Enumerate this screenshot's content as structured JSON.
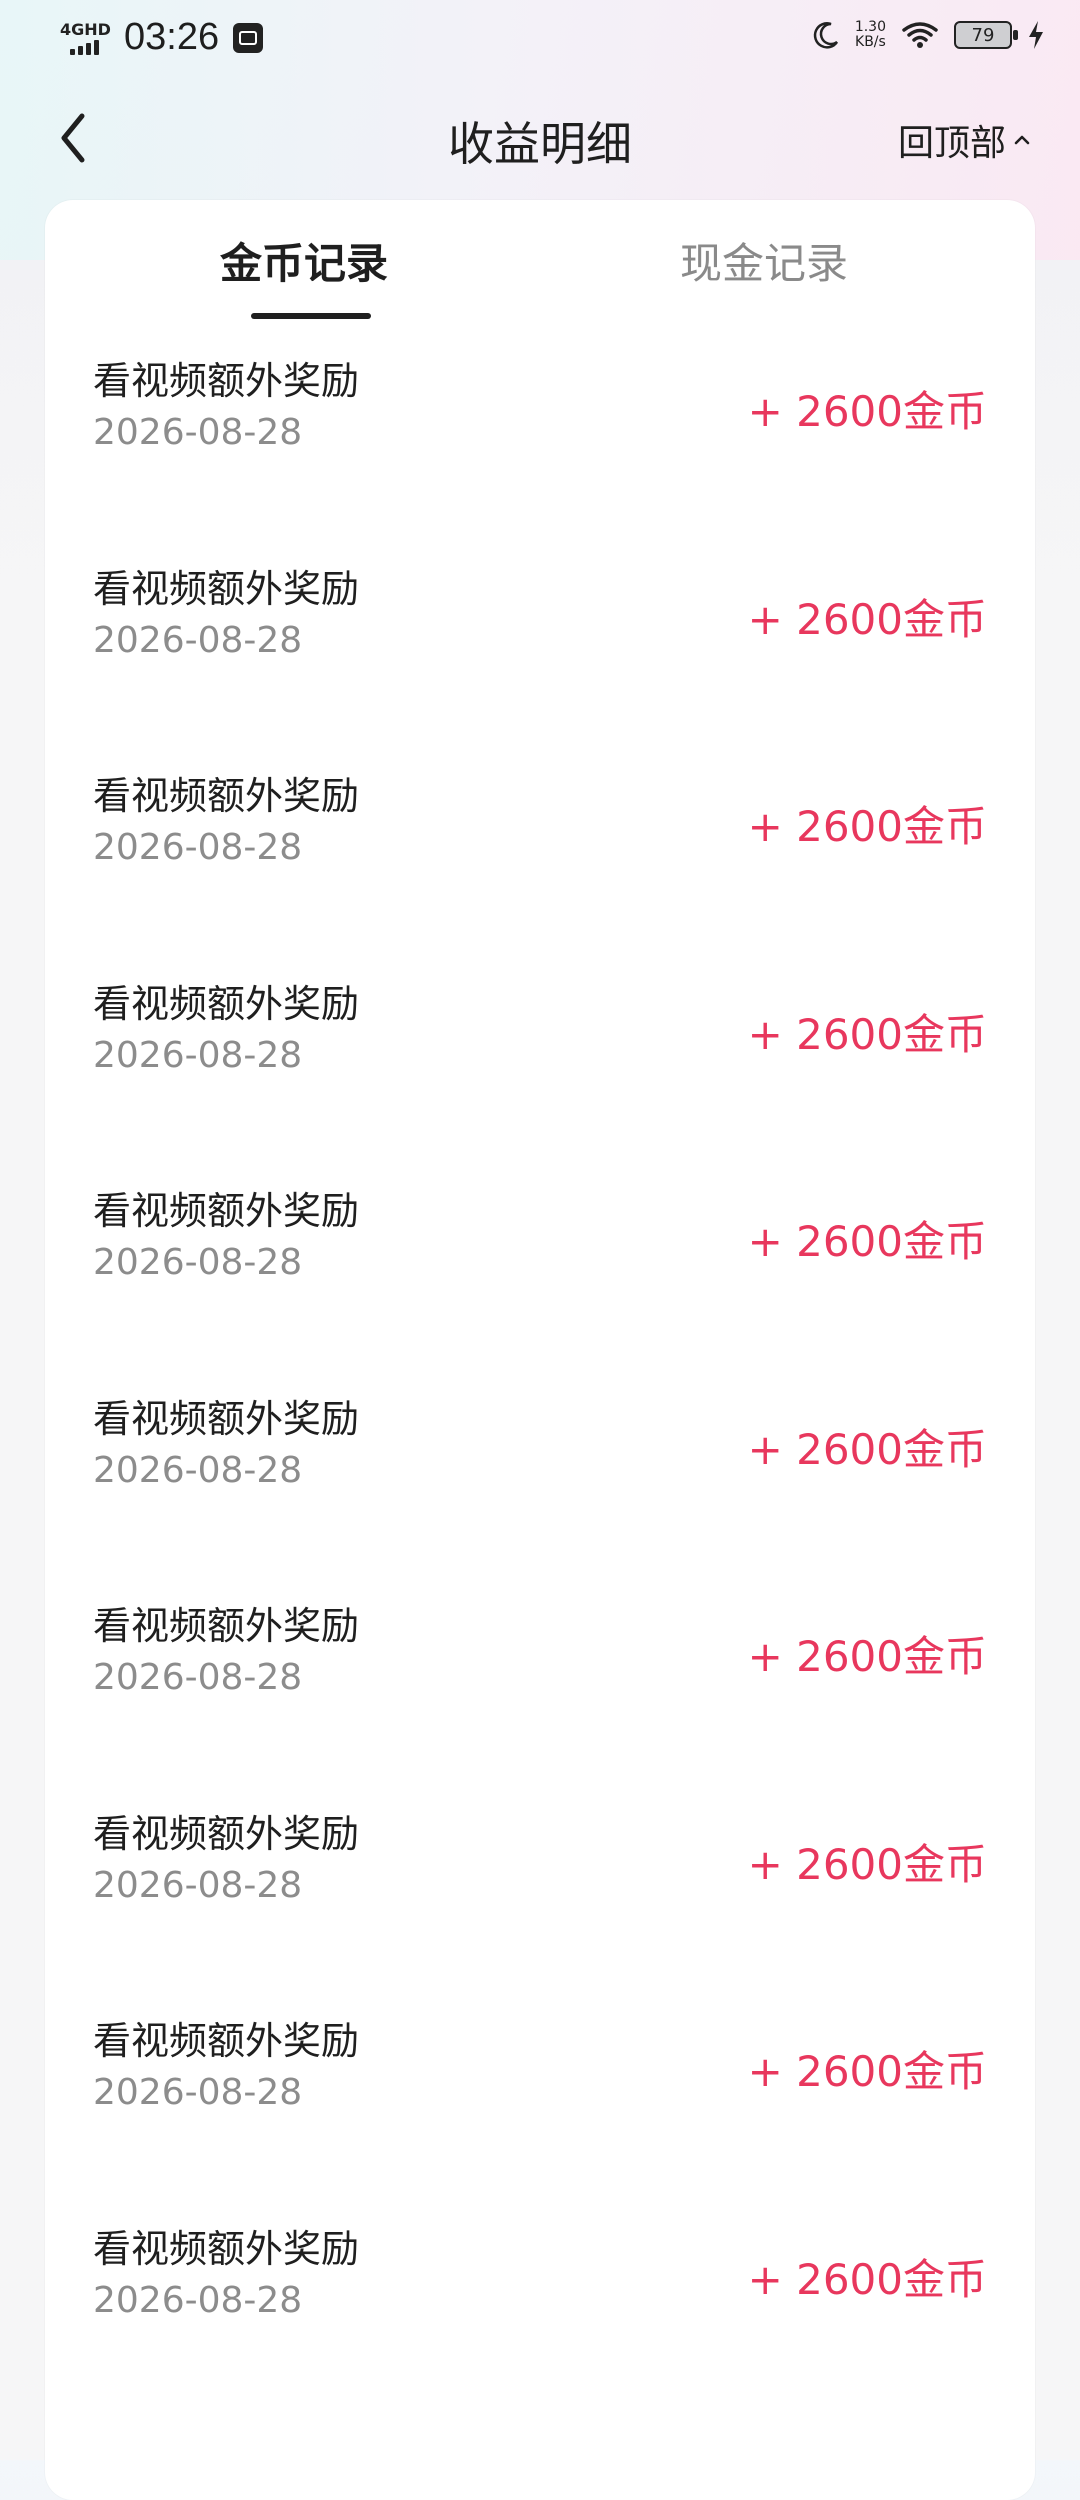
{
  "status_bar": {
    "network": "4GHD",
    "time": "03:26",
    "speed_value": "1.30",
    "speed_unit": "KB/s",
    "battery": "79"
  },
  "header": {
    "title": "收益明细",
    "top_button_label": "回顶部"
  },
  "tabs": [
    {
      "label": "金币记录",
      "active": true
    },
    {
      "label": "现金记录",
      "active": false
    }
  ],
  "records": [
    {
      "title": "看视频额外奖励",
      "date": "2026-08-28",
      "amount": "+ 2600金币"
    },
    {
      "title": "看视频额外奖励",
      "date": "2026-08-28",
      "amount": "+ 2600金币"
    },
    {
      "title": "看视频额外奖励",
      "date": "2026-08-28",
      "amount": "+ 2600金币"
    },
    {
      "title": "看视频额外奖励",
      "date": "2026-08-28",
      "amount": "+ 2600金币"
    },
    {
      "title": "看视频额外奖励",
      "date": "2026-08-28",
      "amount": "+ 2600金币"
    },
    {
      "title": "看视频额外奖励",
      "date": "2026-08-28",
      "amount": "+ 2600金币"
    },
    {
      "title": "看视频额外奖励",
      "date": "2026-08-28",
      "amount": "+ 2600金币"
    },
    {
      "title": "看视频额外奖励",
      "date": "2026-08-28",
      "amount": "+ 2600金币"
    },
    {
      "title": "看视频额外奖励",
      "date": "2026-08-28",
      "amount": "+ 2600金币"
    },
    {
      "title": "看视频额外奖励",
      "date": "2026-08-28",
      "amount": "+ 2600金币"
    }
  ],
  "colors": {
    "accent": "#e8375d",
    "title_text": "#1f1f1f",
    "muted_text": "#8c8c8c"
  }
}
